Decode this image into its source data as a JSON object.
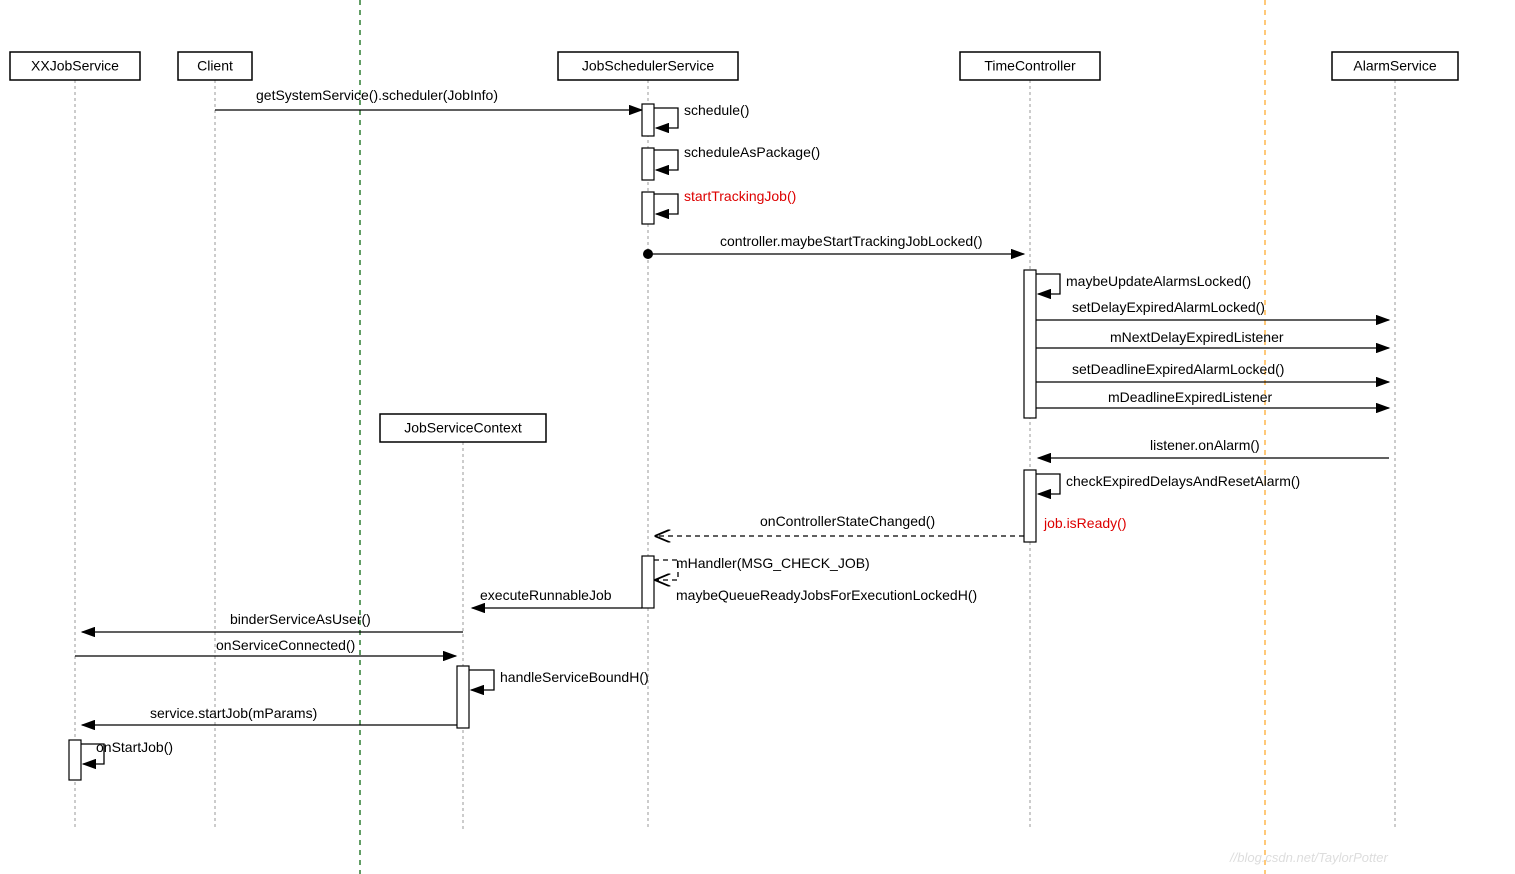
{
  "participants": {
    "xxjob": "XXJobService",
    "client": "Client",
    "jobctx": "JobServiceContext",
    "jss": "JobSchedulerService",
    "tc": "TimeController",
    "alarm": "AlarmService"
  },
  "messages": {
    "m1": "getSystemService().scheduler(JobInfo)",
    "m2": "schedule()",
    "m3": "scheduleAsPackage()",
    "m4": "startTrackingJob()",
    "m5": "controller.maybeStartTrackingJobLocked()",
    "m6": "maybeUpdateAlarmsLocked()",
    "m7": "setDelayExpiredAlarmLocked()",
    "m8": "mNextDelayExpiredListener",
    "m9": "setDeadlineExpiredAlarmLocked()",
    "m10": "mDeadlineExpiredListener",
    "m11": "listener.onAlarm()",
    "m12": "checkExpiredDelaysAndResetAlarm()",
    "m13": "onControllerStateChanged()",
    "m14": "job.isReady()",
    "m15": "mHandler(MSG_CHECK_JOB)",
    "m16": "maybeQueueReadyJobsForExecutionLockedH()",
    "m17": "executeRunnableJob",
    "m18": "binderServiceAsUser()",
    "m19": "onServiceConnected()",
    "m20": "handleServiceBoundH()",
    "m21": "service.startJob(mParams)",
    "m22": "onStartJob()"
  },
  "watermark": "//blog.csdn.net/TaylorPotter"
}
